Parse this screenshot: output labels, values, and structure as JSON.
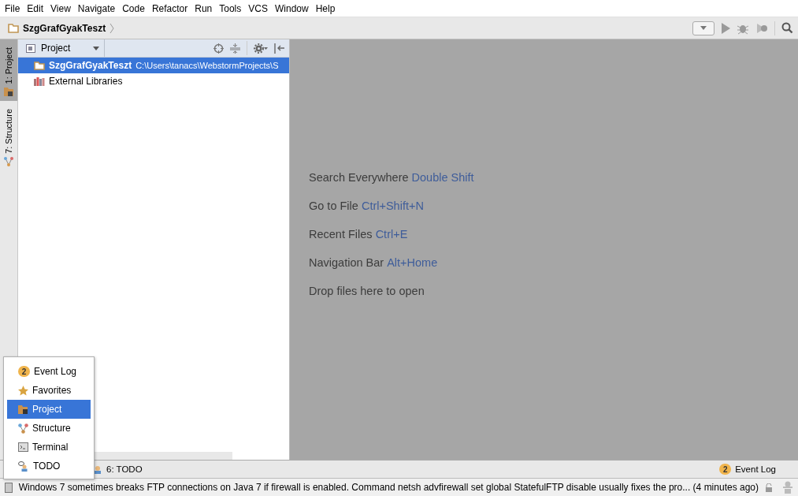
{
  "menu_bar": [
    "File",
    "Edit",
    "View",
    "Navigate",
    "Code",
    "Refactor",
    "Run",
    "Tools",
    "VCS",
    "Window",
    "Help"
  ],
  "nav_bar": {
    "breadcrumb": "SzgGrafGyakTeszt"
  },
  "side_tabs": [
    {
      "label": "1: Project",
      "kind": "project",
      "selected": true
    },
    {
      "label": "7: Structure",
      "kind": "structure",
      "selected": false
    }
  ],
  "project_panel": {
    "view_selector": "Project",
    "tree": [
      {
        "name": "SzgGrafGyakTeszt",
        "path": "C:\\Users\\tanacs\\WebstormProjects\\S",
        "kind": "folder",
        "selected": true
      },
      {
        "name": "External Libraries",
        "kind": "library",
        "selected": false
      }
    ]
  },
  "editor_hints": [
    {
      "label": "Search Everywhere",
      "shortcut": "Double Shift"
    },
    {
      "label": "Go to File",
      "shortcut": "Ctrl+Shift+N"
    },
    {
      "label": "Recent Files",
      "shortcut": "Ctrl+E"
    },
    {
      "label": "Navigation Bar",
      "shortcut": "Alt+Home"
    },
    {
      "label": "Drop files here to open"
    }
  ],
  "tool_window_popup": [
    {
      "label": "Event Log",
      "kind": "eventlog",
      "badge": "2",
      "selected": false
    },
    {
      "label": "Favorites",
      "kind": "star",
      "selected": false
    },
    {
      "label": "Project",
      "kind": "project",
      "selected": true
    },
    {
      "label": "Structure",
      "kind": "structure",
      "selected": false
    },
    {
      "label": "Terminal",
      "kind": "terminal",
      "selected": false
    },
    {
      "label": "TODO",
      "kind": "todo",
      "selected": false
    }
  ],
  "bottom_tool_bar": {
    "left_tab": "6: TODO",
    "right_tab": {
      "label": "Event Log",
      "badge": "2"
    }
  },
  "status_bar": {
    "message": "Windows 7 sometimes breaks FTP connections on Java 7 if firewall is enabled. Command netsh advfirewall set global StatefulFTP disable usually fixes the pro... (4 minutes ago)"
  }
}
